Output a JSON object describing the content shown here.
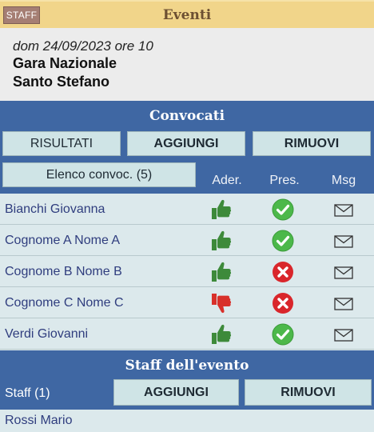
{
  "header": {
    "badge": "STAFF",
    "title": "Eventi"
  },
  "event": {
    "date": "dom 24/09/2023 ore 10",
    "name_line1": "Gara Nazionale",
    "name_line2": "Santo Stefano"
  },
  "convocati": {
    "title": "Convocati",
    "btn_results": "RISULTATI",
    "btn_add": "AGGIUNGI",
    "btn_remove": "RIMUOVI",
    "list_button": "Elenco convoc. (5)",
    "col_adhesion": "Ader.",
    "col_presence": "Pres.",
    "col_message": "Msg",
    "rows": [
      {
        "name": "Bianchi Giovanna",
        "adhesion": "thumbs-up",
        "presence": "present"
      },
      {
        "name": "Cognome A Nome A",
        "adhesion": "thumbs-up",
        "presence": "present"
      },
      {
        "name": "Cognome B Nome B",
        "adhesion": "thumbs-up",
        "presence": "absent"
      },
      {
        "name": "Cognome C  Nome C",
        "adhesion": "thumbs-down",
        "presence": "absent"
      },
      {
        "name": "Verdi Giovanni",
        "adhesion": "thumbs-up",
        "presence": "present"
      }
    ]
  },
  "staff": {
    "title": "Staff dell'evento",
    "label": "Staff (1)",
    "btn_add": "AGGIUNGI",
    "btn_remove": "RIMUOVI",
    "members": [
      "Rossi Mario"
    ]
  },
  "colors": {
    "thumb_up": "#3d8a3a",
    "thumb_down": "#d8302a",
    "present": "#4cb84a",
    "absent": "#d9262b",
    "header_bar": "#f1d58a",
    "blue": "#3f67a3"
  }
}
